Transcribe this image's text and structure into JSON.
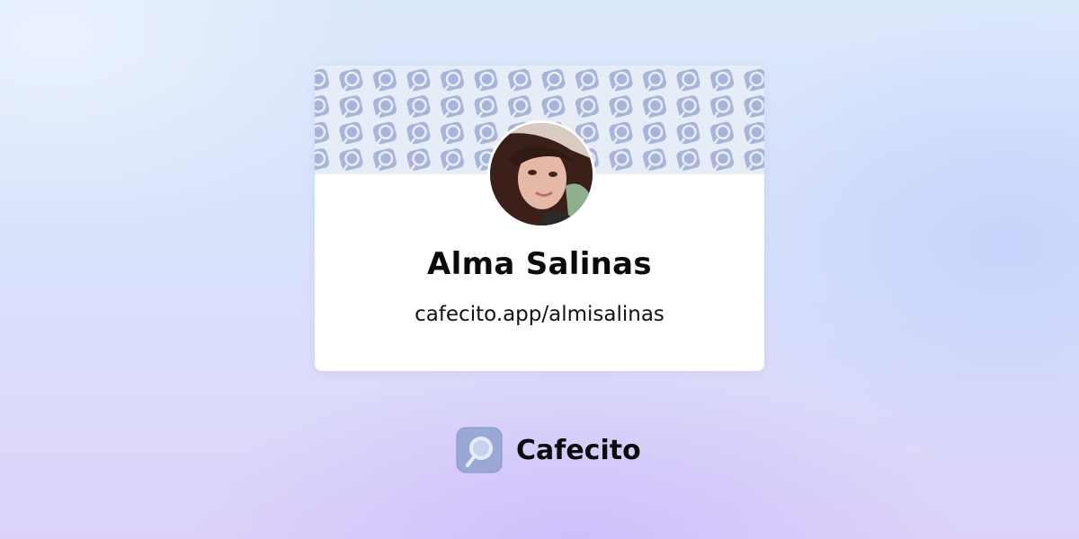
{
  "profile": {
    "name": "Alma Salinas",
    "url": "cafecito.app/almisalinas"
  },
  "brand": {
    "name": "Cafecito",
    "logo_icon": "coffee-cup-logo-icon"
  },
  "banner": {
    "pattern_icon": "coffee-cup-icon"
  },
  "colors": {
    "pattern_icon": "#a8b4d9",
    "banner_bg": "#e7edf7",
    "card_bg": "#ffffff",
    "text": "#0b0b0b",
    "logo_bg": "#9aa8d6"
  }
}
